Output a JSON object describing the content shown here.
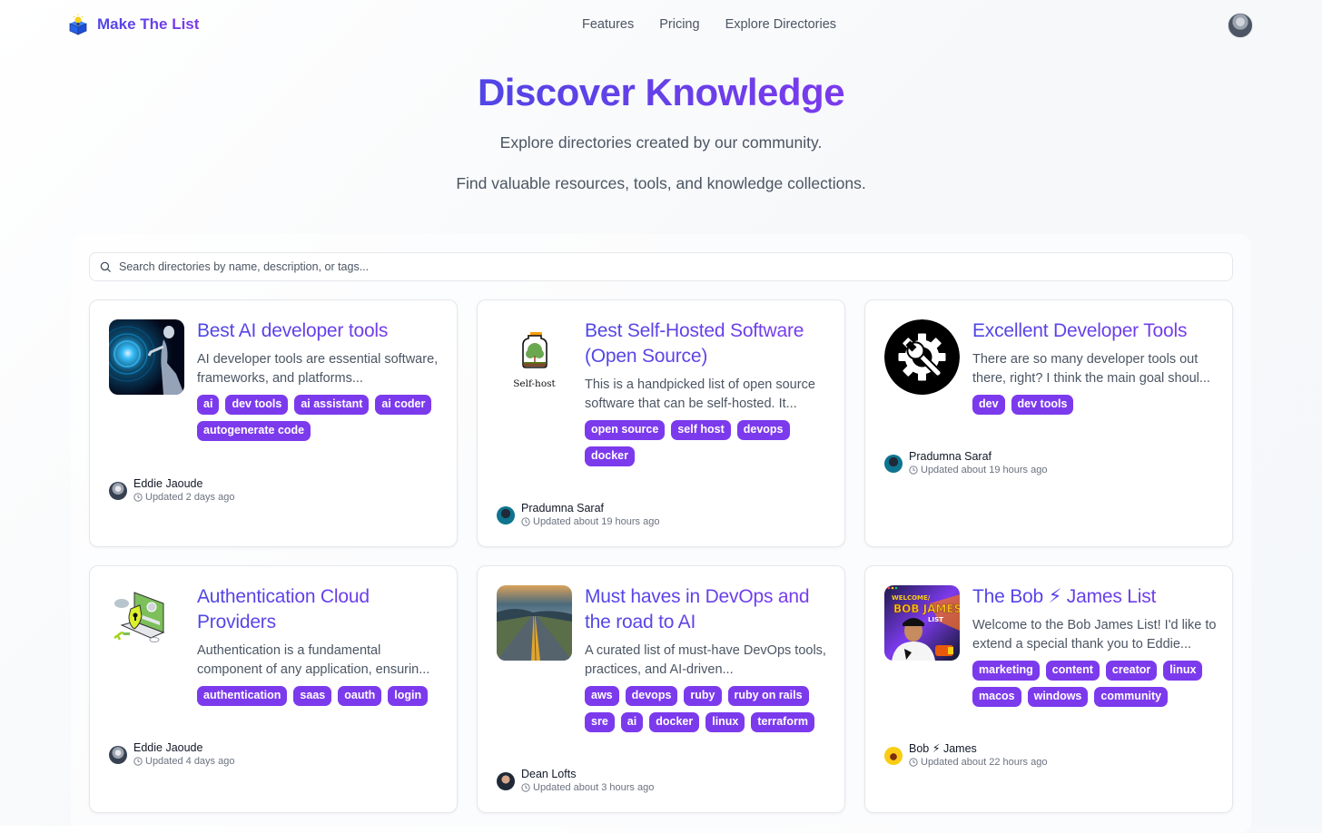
{
  "header": {
    "brand": "Make The List",
    "nav": [
      "Features",
      "Pricing",
      "Explore Directories"
    ]
  },
  "hero": {
    "title": "Discover Knowledge",
    "subtitle1": "Explore directories created by our community.",
    "subtitle2": "Find valuable resources, tools, and knowledge collections."
  },
  "search": {
    "placeholder": "Search directories by name, description, or tags...",
    "value": ""
  },
  "colors": {
    "accent": "#7c3aed",
    "title_gradient_start": "#4f46e5",
    "title_gradient_end": "#7c3aed"
  },
  "cards": [
    {
      "title": "Best AI developer tools",
      "description": "AI developer tools are essential software, frameworks, and platforms...",
      "tags": [
        "ai",
        "dev tools",
        "ai assistant",
        "ai coder",
        "autogenerate code"
      ],
      "author": "Eddie Jaoude",
      "updated": "Updated 2 days ago",
      "thumb_icon": "ai-robot-image"
    },
    {
      "title": "Best Self-Hosted Software (Open Source)",
      "description": "This is a handpicked list of open source software that can be self-hosted. It...",
      "tags": [
        "open source",
        "self host",
        "devops",
        "docker"
      ],
      "author": "Pradumna Saraf",
      "updated": "Updated about 19 hours ago",
      "thumb_icon": "self-host-jar-image",
      "thumb_caption": "Self-host"
    },
    {
      "title": "Excellent Developer Tools",
      "description": "There are so many developer tools out there, right? I think the main goal shoul...",
      "tags": [
        "dev",
        "dev tools"
      ],
      "author": "Pradumna Saraf",
      "updated": "Updated about 19 hours ago",
      "thumb_icon": "gear-wrench-image"
    },
    {
      "title": "Authentication Cloud Providers",
      "description": "Authentication is a fundamental component of any application, ensurin...",
      "tags": [
        "authentication",
        "saas",
        "oauth",
        "login"
      ],
      "author": "Eddie Jaoude",
      "updated": "Updated 4 days ago",
      "thumb_icon": "auth-laptop-shield-image"
    },
    {
      "title": "Must haves in DevOps and the road to AI",
      "description": "A curated list of must-have DevOps tools, practices, and AI-driven...",
      "tags": [
        "aws",
        "devops",
        "ruby",
        "ruby on rails",
        "sre",
        "ai",
        "docker",
        "linux",
        "terraform"
      ],
      "author": "Dean Lofts",
      "updated": "Updated about 3 hours ago",
      "thumb_icon": "road-landscape-image"
    },
    {
      "title": "The Bob ⚡ James List",
      "description": "Welcome to the Bob James List! I'd like to extend a special thank you to Eddie...",
      "tags": [
        "marketing",
        "content",
        "creator",
        "linux",
        "macos",
        "windows",
        "community"
      ],
      "author": "Bob ⚡ James",
      "updated": "Updated about 22 hours ago",
      "thumb_icon": "bob-james-welcome-image"
    }
  ]
}
